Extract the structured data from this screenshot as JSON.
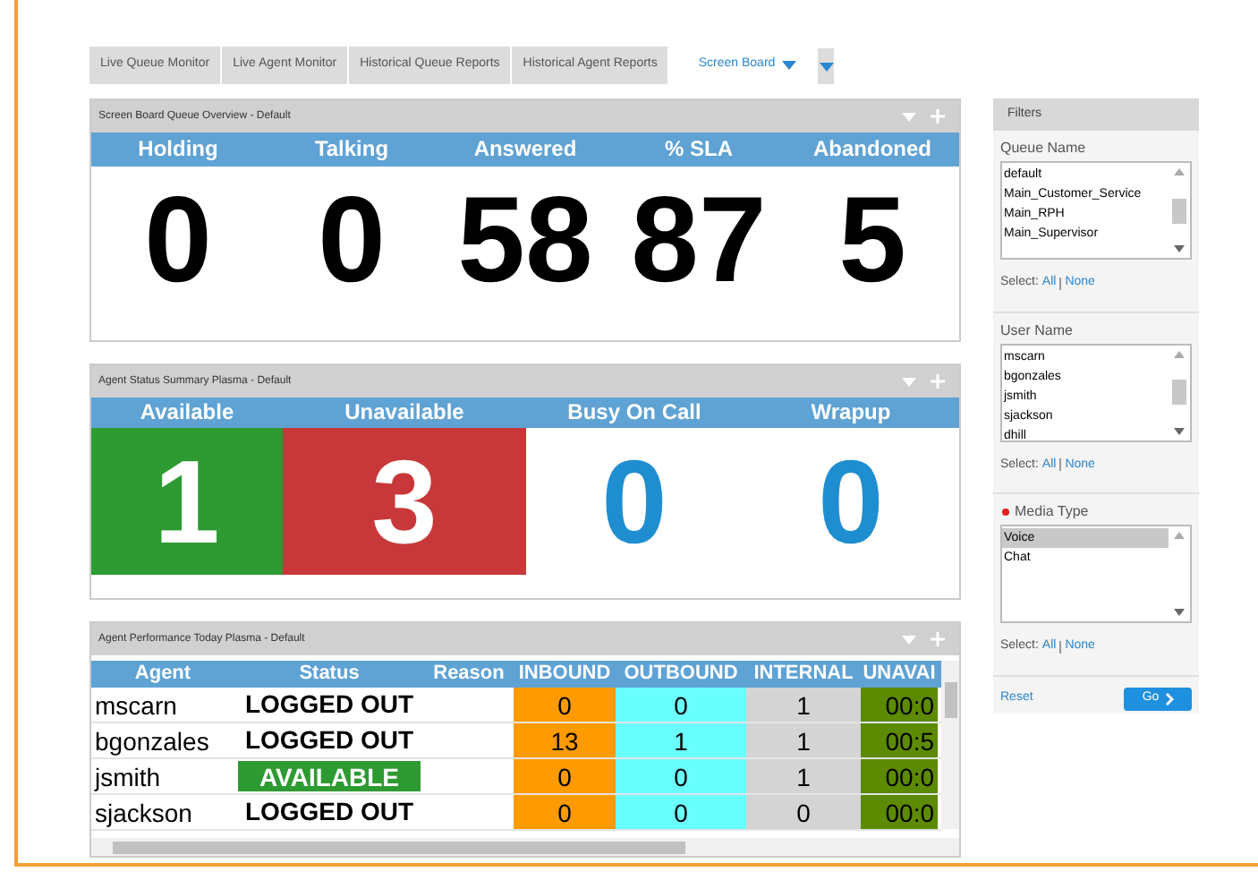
{
  "tabs": [
    {
      "label": "Live Queue Monitor",
      "selected": false
    },
    {
      "label": "Live Agent Monitor",
      "selected": false
    },
    {
      "label": "Historical Queue Reports",
      "selected": false
    },
    {
      "label": "Historical Agent Reports",
      "selected": false
    },
    {
      "label": "Screen Board",
      "selected": true
    }
  ],
  "queue_overview": {
    "title": "Screen Board Queue Overview - Default",
    "metrics": [
      {
        "label": "Holding",
        "value": "0"
      },
      {
        "label": "Talking",
        "value": "0"
      },
      {
        "label": "Answered",
        "value": "58"
      },
      {
        "label": "% SLA",
        "value": "87"
      },
      {
        "label": "Abandoned",
        "value": "5"
      }
    ]
  },
  "status_summary": {
    "title": "Agent Status Summary Plasma - Default",
    "metrics": [
      {
        "label": "Available",
        "value": "1",
        "color": "#2e9a32"
      },
      {
        "label": "Unavailable",
        "value": "3",
        "color": "#c8383a"
      },
      {
        "label": "Busy On Call",
        "value": "0",
        "color": "#ffffff"
      },
      {
        "label": "Wrapup",
        "value": "0",
        "color": "#ffffff"
      }
    ]
  },
  "performance": {
    "title": "Agent Performance Today Plasma - Default",
    "columns": [
      "Agent",
      "Status",
      "Reason",
      "INBOUND",
      "OUTBOUND",
      "INTERNAL",
      "UNAVAI"
    ],
    "rows": [
      {
        "agent": "mscarn",
        "status": "LOGGED OUT",
        "kind": "logged_out",
        "inbound": "0",
        "outbound": "0",
        "internal": "1",
        "unavailable": "00:0"
      },
      {
        "agent": "bgonzales",
        "status": "LOGGED OUT",
        "kind": "logged_out",
        "inbound": "13",
        "outbound": "1",
        "internal": "1",
        "unavailable": "00:5"
      },
      {
        "agent": "jsmith",
        "status": "AVAILABLE",
        "kind": "available",
        "inbound": "0",
        "outbound": "0",
        "internal": "1",
        "unavailable": "00:0"
      },
      {
        "agent": "sjackson",
        "status": "LOGGED OUT",
        "kind": "logged_out",
        "inbound": "0",
        "outbound": "0",
        "internal": "0",
        "unavailable": "00:0"
      }
    ]
  },
  "filters": {
    "title": "Filters",
    "groups": [
      {
        "label": "Queue Name",
        "required": false,
        "items": [
          {
            "label": "default",
            "selected": false
          },
          {
            "label": "Main_Customer_Service",
            "selected": false
          },
          {
            "label": "Main_RPH",
            "selected": false
          },
          {
            "label": "Main_Supervisor",
            "selected": false
          }
        ],
        "select_label": "Select:",
        "all": "All",
        "none": "None"
      },
      {
        "label": "User Name",
        "required": false,
        "items": [
          {
            "label": "mscarn",
            "selected": false
          },
          {
            "label": "bgonzales",
            "selected": false
          },
          {
            "label": "jsmith",
            "selected": false
          },
          {
            "label": "sjackson",
            "selected": false
          },
          {
            "label": "dhill",
            "selected": false
          }
        ],
        "select_label": "Select:",
        "all": "All",
        "none": "None"
      },
      {
        "label": "Media Type",
        "required": true,
        "items": [
          {
            "label": "Voice",
            "selected": true
          },
          {
            "label": "Chat",
            "selected": false
          }
        ],
        "select_label": "Select:",
        "all": "All",
        "none": "None"
      }
    ],
    "reset": "Reset",
    "go": "Go"
  }
}
